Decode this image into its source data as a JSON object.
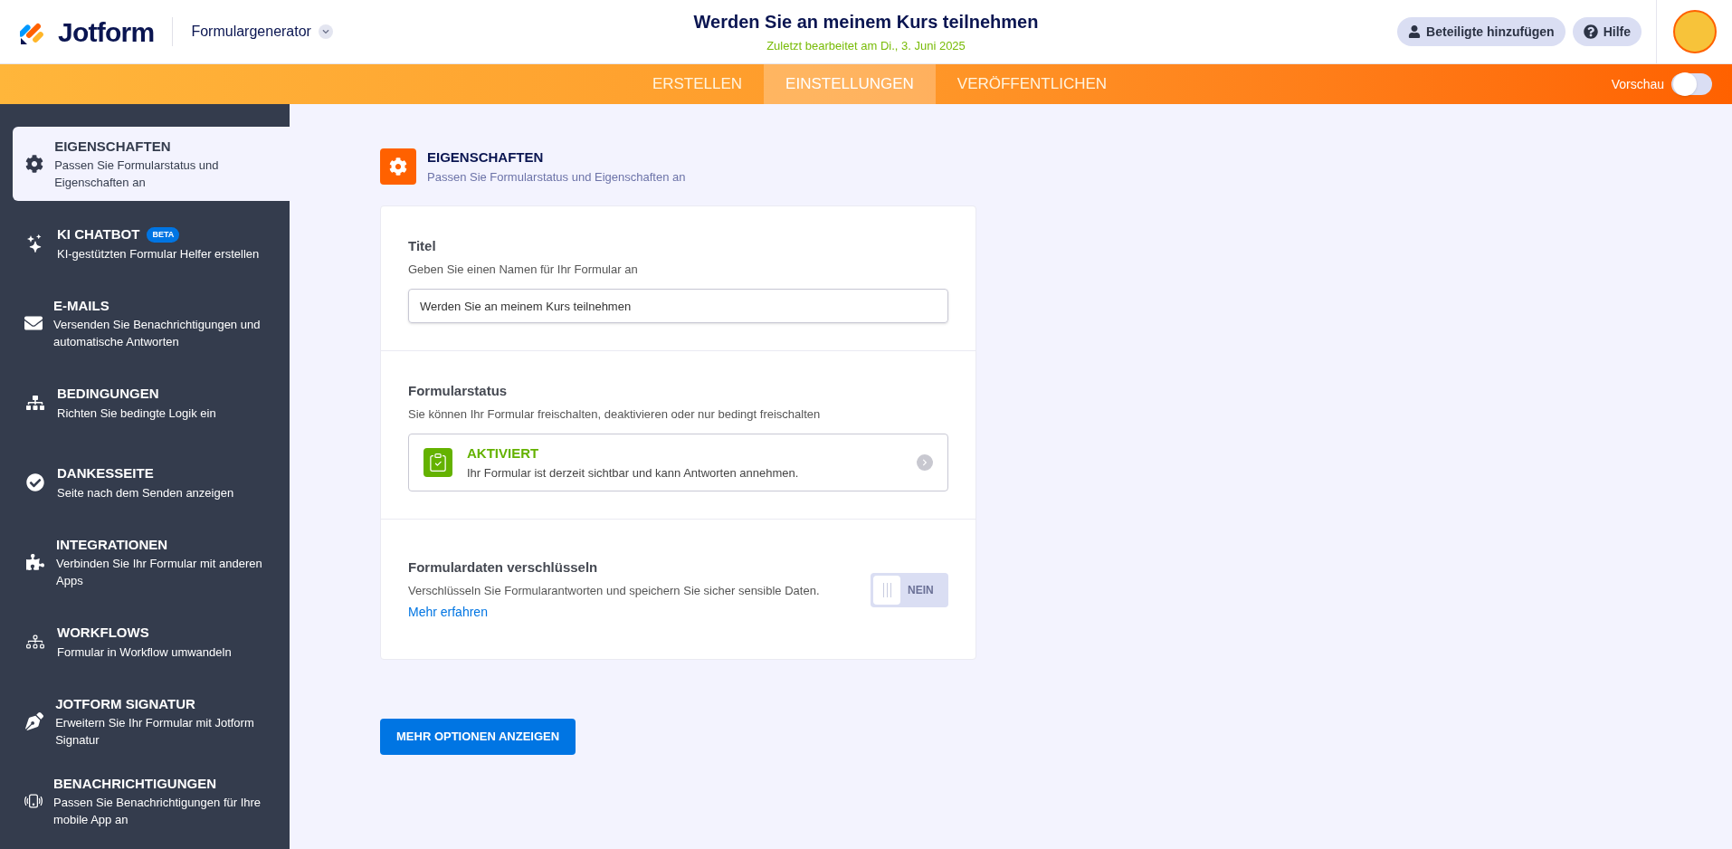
{
  "header": {
    "logo": "Jotform",
    "app_menu": "Formulargenerator",
    "form_title": "Werden Sie an meinem Kurs teilnehmen",
    "last_edited": "Zuletzt bearbeitet am Di., 3. Juni 2025",
    "buttons": [
      {
        "kind": "person",
        "label": "Beteiligte hinzufügen"
      },
      {
        "kind": "help",
        "label": "Hilfe"
      }
    ]
  },
  "tabs": [
    {
      "label": "ERSTELLEN",
      "selected": false
    },
    {
      "label": "EINSTELLUNGEN",
      "selected": true
    },
    {
      "label": "VERÖFFENTLICHEN",
      "selected": false
    }
  ],
  "preview": {
    "label": "Vorschau",
    "on": false
  },
  "sidebar": {
    "items": [
      {
        "kind": "gear",
        "title": "EIGENSCHAFTEN",
        "description": "Passen Sie Formularstatus und Eigenschaften an",
        "selected": true
      },
      {
        "kind": "chatbot",
        "title": "KI CHATBOT",
        "badge": "BETA",
        "description": "KI-gestützten Formular Helfer erstellen",
        "selected": false
      },
      {
        "kind": "mail",
        "title": "E-MAILS",
        "description": "Versenden Sie Benachrichtigungen und automatische Antworten",
        "selected": false
      },
      {
        "kind": "tree",
        "title": "BEDINGUNGEN",
        "description": "Richten Sie bedingte Logik ein",
        "selected": false
      },
      {
        "kind": "check",
        "title": "DANKESSEITE",
        "description": "Seite nach dem Senden anzeigen",
        "selected": false
      },
      {
        "kind": "puzzle",
        "title": "INTEGRATIONEN",
        "description": "Verbinden Sie Ihr Formular mit anderen Apps",
        "selected": false
      },
      {
        "kind": "workflow",
        "title": "WORKFLOWS",
        "description": "Formular in Workflow umwandeln",
        "selected": false
      },
      {
        "kind": "pen",
        "title": "JOTFORM SIGNATUR",
        "description": "Erweitern Sie Ihr Formular mit Jotform Signatur",
        "selected": false
      },
      {
        "kind": "phone",
        "title": "BENACHRICHTIGUNGEN",
        "description": "Passen Sie Benachrichtigungen für Ihre mobile App an",
        "selected": false
      }
    ]
  },
  "section": {
    "title": "EIGENSCHAFTEN",
    "subtitle": "Passen Sie Formularstatus und Eigenschaften an"
  },
  "title_setting": {
    "label": "Titel",
    "hint": "Geben Sie einen Namen für Ihr Formular an",
    "value": "Werden Sie an meinem Kurs teilnehmen"
  },
  "status_setting": {
    "label": "Formularstatus",
    "hint": "Sie können Ihr Formular freischalten, deaktivieren oder nur bedingt freischalten",
    "status": "AKTIVIERT",
    "status_text": "Ihr Formular ist derzeit sichtbar und kann Antworten annehmen."
  },
  "encrypt_setting": {
    "label": "Formulardaten verschlüsseln",
    "hint": "Verschlüsseln Sie Formularantworten und speichern Sie sicher sensible Daten.",
    "link": "Mehr erfahren",
    "on": false,
    "toggle_label": "NEIN"
  },
  "more_button": "MEHR OPTIONEN ANZEIGEN"
}
